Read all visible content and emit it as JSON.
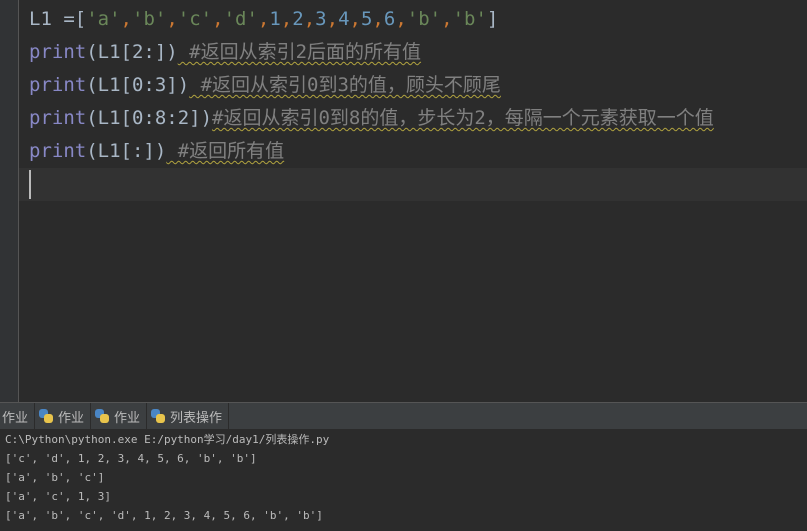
{
  "editor": {
    "lines": [
      {
        "code_start": "L1 =",
        "tokens": [
          "[",
          "'a'",
          ",",
          "'b'",
          ",",
          "'c'",
          ",",
          "'d'",
          ",",
          "1",
          ",",
          "2",
          ",",
          "3",
          ",",
          "4",
          ",",
          "5",
          ",",
          "6",
          ",",
          "'b'",
          ",",
          "'b'",
          "]"
        ]
      },
      {
        "keyword": "print",
        "code": "(L1[2:])",
        "comment": " #返回从索引2后面的所有值"
      },
      {
        "keyword": "print",
        "code": "(L1[0:3])",
        "comment": " #返回从索引0到3的值，顾头不顾尾"
      },
      {
        "keyword": "print",
        "code": "(L1[0:8:2])",
        "comment": "#返回从索引0到8的值，步长为2，每隔一个元素获取一个值"
      },
      {
        "keyword": "print",
        "code": "(L1[:])",
        "comment": " #返回所有值"
      }
    ]
  },
  "run_tabs": [
    {
      "label": "作业",
      "icon": "python-icon"
    },
    {
      "label": "作业",
      "icon": "python-icon"
    },
    {
      "label": "作业",
      "icon": "python-icon"
    },
    {
      "label": "列表操作",
      "icon": "python-icon"
    }
  ],
  "console": {
    "lines": [
      "C:\\Python\\python.exe E:/python学习/day1/列表操作.py",
      "['c', 'd', 1, 2, 3, 4, 5, 6, 'b', 'b']",
      "['a', 'b', 'c']",
      "['a', 'c', 1, 3]",
      "['a', 'b', 'c', 'd', 1, 2, 3, 4, 5, 6, 'b', 'b']"
    ]
  },
  "colors": {
    "editor_bg": "#2b2b2b",
    "keyword": "#8888c6",
    "number": "#6897bb",
    "string": "#6a8759",
    "comment": "#808080"
  }
}
